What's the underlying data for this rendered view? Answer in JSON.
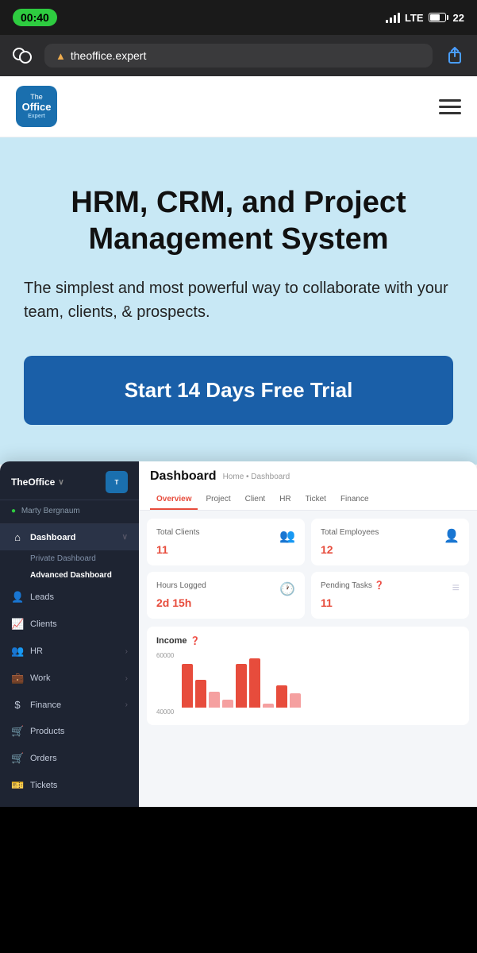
{
  "statusBar": {
    "time": "00:40",
    "signal": "LTE",
    "battery": "22"
  },
  "browserBar": {
    "url": "theoffice.expert",
    "warning": "▲"
  },
  "nav": {
    "logo_line1": "The",
    "logo_line2": "Office",
    "logo_line3": "Expert"
  },
  "hero": {
    "headline": "HRM, CRM, and Project Management System",
    "subtext": "The simplest and most powerful way to collaborate with your team, clients, & prospects.",
    "cta": "Start 14 Days Free Trial"
  },
  "dashboard": {
    "title": "Dashboard",
    "breadcrumb": "Home • Dashboard",
    "tabs": [
      "Overview",
      "Project",
      "Client",
      "HR",
      "Ticket",
      "Finance"
    ],
    "activeTab": "Overview",
    "sidebar": {
      "brand": "TheOffice",
      "user": "Marty Bergnaum",
      "items": [
        {
          "label": "Dashboard",
          "icon": "⌂",
          "active": true,
          "hasArrow": true
        },
        {
          "label": "Leads",
          "icon": "👤",
          "active": false
        },
        {
          "label": "Clients",
          "icon": "📈",
          "active": false
        },
        {
          "label": "HR",
          "icon": "👥",
          "active": false,
          "hasArrow": true
        },
        {
          "label": "Work",
          "icon": "💼",
          "active": false,
          "hasArrow": true
        },
        {
          "label": "Finance",
          "icon": "$",
          "active": false,
          "hasArrow": true
        },
        {
          "label": "Products",
          "icon": "🛒",
          "active": false
        },
        {
          "label": "Orders",
          "icon": "🛒",
          "active": false
        },
        {
          "label": "Tickets",
          "icon": "🎫",
          "active": false
        }
      ],
      "subItems": [
        {
          "label": "Private Dashboard",
          "active": false
        },
        {
          "label": "Advanced Dashboard",
          "active": true
        }
      ]
    },
    "cards": [
      {
        "label": "Total Clients",
        "value": "11",
        "icon": "👥"
      },
      {
        "label": "Total Employees",
        "value": "12",
        "icon": "👤"
      },
      {
        "label": "Hours Logged",
        "value": "2d 15h",
        "icon": "🕐"
      },
      {
        "label": "Pending Tasks ❓",
        "value": "11",
        "icon": "≡"
      }
    ],
    "income": {
      "title": "Income",
      "yLabels": [
        "60000",
        "40000"
      ],
      "bars": [
        {
          "height": 55,
          "light": false
        },
        {
          "height": 35,
          "light": false
        },
        {
          "height": 20,
          "light": true
        },
        {
          "height": 10,
          "light": true
        },
        {
          "height": 55,
          "light": false
        },
        {
          "height": 65,
          "light": false
        },
        {
          "height": 5,
          "light": true
        },
        {
          "height": 28,
          "light": false
        },
        {
          "height": 18,
          "light": true
        }
      ]
    }
  }
}
